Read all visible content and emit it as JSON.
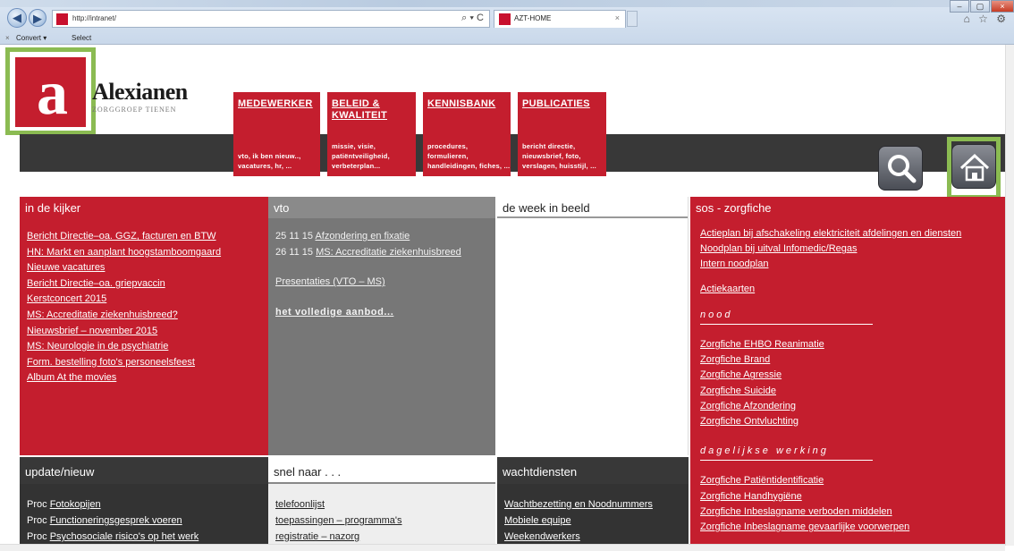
{
  "browser": {
    "url": "http://intranet/",
    "tab_title": "AZT-HOME",
    "tab_close": "×",
    "address_tools": "⌕ ▾ C",
    "min": "–",
    "max": "▢",
    "close": "×",
    "right_icons": "⌂ ☆ ⚙",
    "cmd_close": "×",
    "cmd_convert": "Convert ▾",
    "cmd_select": "Select"
  },
  "brand": {
    "name": "Alexianen",
    "sub": "ZORGGROEP TIENEN",
    "mark": "a"
  },
  "menu": [
    {
      "title": "MEDEWERKER",
      "sub": "vto, ik ben nieuw.., vacatures, hr, ..."
    },
    {
      "title": "BELEID & KWALITEIT",
      "sub": "missie, visie, patiëntveiligheid, verbeterplan..."
    },
    {
      "title": "KENNISBANK",
      "sub": "procedures, formulieren, handleidingen, fiches, ..."
    },
    {
      "title": "PUBLICATIES",
      "sub": "bericht directie, nieuwsbrief, foto, verslagen, huisstijl, ..."
    }
  ],
  "columns": {
    "kijker": {
      "title": "in de kijker",
      "links": [
        "Bericht Directie–oa. GGZ, facturen en BTW",
        "HN: Markt en aanplant hoogstamboomgaard",
        "Nieuwe vacatures",
        "Bericht Directie–oa. griepvaccin",
        "Kerstconcert 2015",
        "MS: Accreditatie ziekenhuisbreed?",
        "Nieuwsbrief – november 2015",
        "MS: Neurologie in de psychiatrie",
        "Form. bestelling foto's personeelsfeest",
        "Album At the movies"
      ]
    },
    "vto": {
      "title": "vto",
      "items": [
        {
          "date": "25 11 15",
          "link": "Afzondering en fixatie"
        },
        {
          "date": "26 11 15",
          "link": "MS: Accreditatie ziekenhuisbreed"
        }
      ],
      "presentaties": "Presentaties (VTO – MS)",
      "aanbod": "het volledige aanbod..."
    },
    "week": {
      "title": "de week in beeld"
    },
    "sos": {
      "title": "sos - zorgfiche",
      "links": [
        "Actieplan bij afschakeling elektriciteit afdelingen en diensten",
        "Noodplan bij uitval Infomedic/Regas",
        "Intern noodplan"
      ],
      "actiekaarten": "Actiekaarten",
      "nood_label": "nood",
      "nood": [
        "Zorgfiche EHBO Reanimatie",
        "Zorgfiche Brand",
        "Zorgfiche Agressie",
        "Zorgfiche Suicide",
        "Zorgfiche Afzondering",
        "Zorgfiche Ontvluchting"
      ],
      "dagelijks_label": "dagelijkse werking",
      "dagelijks": [
        "Zorgfiche Patiëntidentificatie",
        "Zorgfiche Handhygiëne",
        "Zorgfiche Inbeslagname verboden middelen",
        "Zorgfiche Inbeslagname gevaarlijke voorwerpen"
      ]
    },
    "update": {
      "title": "update/nieuw",
      "items": [
        {
          "prefix": "Proc",
          "link": "Fotokopijen"
        },
        {
          "prefix": "Proc",
          "link": "Functioneringsgesprek voeren"
        },
        {
          "prefix": "Proc",
          "link": "Psychosociale risico's op het werk"
        }
      ]
    },
    "snel": {
      "title": "snel naar . . .",
      "links": [
        "telefoonlijst",
        "toepassingen – programma's",
        "registratie – nazorg"
      ]
    },
    "wacht": {
      "title": "wachtdiensten",
      "links": [
        "Wachtbezetting en Noodnummers",
        "Mobiele equipe",
        "Weekendwerkers"
      ]
    }
  },
  "colors": {
    "red": "#c41e2e",
    "gray": "#777777",
    "dark": "#383838",
    "highlight": "#8bbb52"
  },
  "icons": [
    "back-icon",
    "forward-icon",
    "search-icon",
    "home-icon"
  ]
}
